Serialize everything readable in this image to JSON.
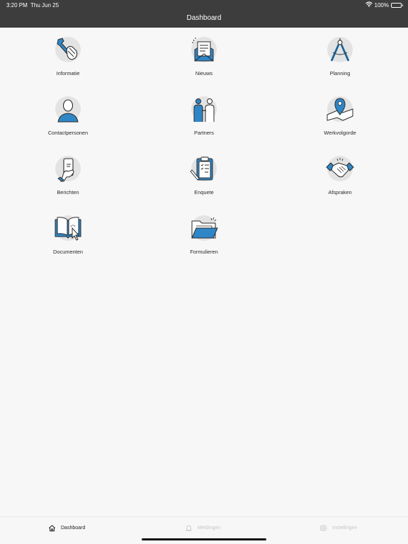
{
  "status_bar": {
    "time": "3:20 PM",
    "date": "Thu Jun 25",
    "battery": "100%",
    "battery_level": 1.0,
    "icons": [
      "wifi-icon",
      "battery-icon"
    ]
  },
  "header": {
    "title": "Dashboard",
    "background": "#3c3d3c"
  },
  "colors": {
    "accent": "#2f86c6",
    "icon_stroke": "#2b2b2b",
    "icon_halo": "#e3e3e3"
  },
  "tiles": [
    {
      "label": "Informatie",
      "icon": "wrench-hand-icon"
    },
    {
      "label": "Nieuws",
      "icon": "newsletter-icon"
    },
    {
      "label": "Planning",
      "icon": "compass-icon"
    },
    {
      "label": "Contactpersonen",
      "icon": "person-icon"
    },
    {
      "label": "Partners",
      "icon": "partners-icon"
    },
    {
      "label": "Werkvolgorde",
      "icon": "map-pin-icon"
    },
    {
      "label": "Berichten",
      "icon": "phone-hand-icon"
    },
    {
      "label": "Enquete",
      "icon": "clipboard-icon"
    },
    {
      "label": "Afspraken",
      "icon": "handshake-icon"
    },
    {
      "label": "Documenten",
      "icon": "book-cursor-icon"
    },
    {
      "label": "Formulieren",
      "icon": "folder-icon"
    }
  ],
  "tabbar": {
    "tabs": [
      {
        "label": "Dashboard",
        "icon": "home-icon",
        "active": true
      },
      {
        "label": "Meldingen",
        "icon": "bell-icon",
        "active": false
      },
      {
        "label": "Instellingen",
        "icon": "settings-icon",
        "active": false
      }
    ]
  }
}
